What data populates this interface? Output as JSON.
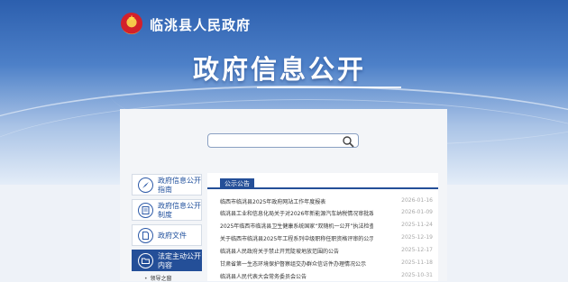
{
  "header": {
    "site_title": "临洮县人民政府",
    "emblem_icon": "national-emblem-icon",
    "page_title": "政府信息公开"
  },
  "search": {
    "value": "",
    "placeholder": "",
    "icon": "search-icon"
  },
  "sidebar": {
    "items": [
      {
        "label": "政府信息公开指南",
        "icon": "compass-icon"
      },
      {
        "label": "政府信息公开制度",
        "icon": "document-list-icon"
      },
      {
        "label": "政府文件",
        "icon": "file-icon"
      },
      {
        "label": "法定主动公开内容",
        "icon": "folder-icon",
        "active": true
      }
    ],
    "sub_items": [
      "领导之窗"
    ]
  },
  "notices": {
    "tab_label": "公示公告",
    "rows": [
      {
        "title": "临西市临洮县2025年政府网站工作年度报表",
        "date": "2026-01-16"
      },
      {
        "title": "临洮县工业和信息化局关于对2026年新能源汽车纳税情况审批政策的意...",
        "date": "2026-01-09"
      },
      {
        "title": "2025年临西市临洮县卫生健康系统国家“双随机一公开”执法检查情况公...",
        "date": "2025-11-24"
      },
      {
        "title": "关于临西市临洮县2025年工程系列中级职称任职资格评审的公示",
        "date": "2025-12-19"
      },
      {
        "title": "临洮县人民政府关于禁止开荒陡坡地放范围的公告",
        "date": "2025-12-17"
      },
      {
        "title": "甘肃省第一生态环境保护督察组交办群众信访件办理情况公示",
        "date": "2025-11-18"
      },
      {
        "title": "临洮县人民代表大会常务委员会公告",
        "date": "2025-10-31"
      }
    ]
  }
}
